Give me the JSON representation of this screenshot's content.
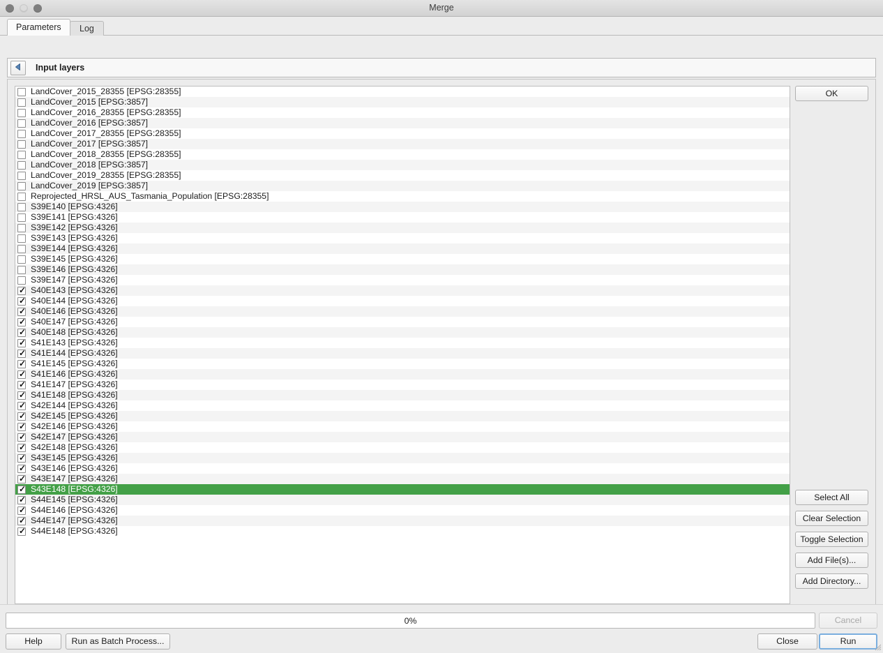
{
  "window": {
    "title": "Merge",
    "traffic_lights": [
      "close-button",
      "minimize-button",
      "zoom-button"
    ]
  },
  "tabs": [
    {
      "label": "Parameters",
      "active": true
    },
    {
      "label": "Log",
      "active": false
    }
  ],
  "parameters": {
    "section_title": "Input layers",
    "collapse_icon": "triangle-left-icon"
  },
  "layer_list": {
    "items": [
      {
        "label": "LandCover_2015_28355 [EPSG:28355]",
        "checked": false,
        "selected": false
      },
      {
        "label": "LandCover_2015 [EPSG:3857]",
        "checked": false,
        "selected": false
      },
      {
        "label": "LandCover_2016_28355 [EPSG:28355]",
        "checked": false,
        "selected": false
      },
      {
        "label": "LandCover_2016 [EPSG:3857]",
        "checked": false,
        "selected": false
      },
      {
        "label": "LandCover_2017_28355 [EPSG:28355]",
        "checked": false,
        "selected": false
      },
      {
        "label": "LandCover_2017 [EPSG:3857]",
        "checked": false,
        "selected": false
      },
      {
        "label": "LandCover_2018_28355 [EPSG:28355]",
        "checked": false,
        "selected": false
      },
      {
        "label": "LandCover_2018 [EPSG:3857]",
        "checked": false,
        "selected": false
      },
      {
        "label": "LandCover_2019_28355 [EPSG:28355]",
        "checked": false,
        "selected": false
      },
      {
        "label": "LandCover_2019 [EPSG:3857]",
        "checked": false,
        "selected": false
      },
      {
        "label": "Reprojected_HRSL_AUS_Tasmania_Population [EPSG:28355]",
        "checked": false,
        "selected": false
      },
      {
        "label": "S39E140 [EPSG:4326]",
        "checked": false,
        "selected": false
      },
      {
        "label": "S39E141 [EPSG:4326]",
        "checked": false,
        "selected": false
      },
      {
        "label": "S39E142 [EPSG:4326]",
        "checked": false,
        "selected": false
      },
      {
        "label": "S39E143 [EPSG:4326]",
        "checked": false,
        "selected": false
      },
      {
        "label": "S39E144 [EPSG:4326]",
        "checked": false,
        "selected": false
      },
      {
        "label": "S39E145 [EPSG:4326]",
        "checked": false,
        "selected": false
      },
      {
        "label": "S39E146 [EPSG:4326]",
        "checked": false,
        "selected": false
      },
      {
        "label": "S39E147 [EPSG:4326]",
        "checked": false,
        "selected": false
      },
      {
        "label": "S40E143 [EPSG:4326]",
        "checked": true,
        "selected": false
      },
      {
        "label": "S40E144 [EPSG:4326]",
        "checked": true,
        "selected": false
      },
      {
        "label": "S40E146 [EPSG:4326]",
        "checked": true,
        "selected": false
      },
      {
        "label": "S40E147 [EPSG:4326]",
        "checked": true,
        "selected": false
      },
      {
        "label": "S40E148 [EPSG:4326]",
        "checked": true,
        "selected": false
      },
      {
        "label": "S41E143 [EPSG:4326]",
        "checked": true,
        "selected": false
      },
      {
        "label": "S41E144 [EPSG:4326]",
        "checked": true,
        "selected": false
      },
      {
        "label": "S41E145 [EPSG:4326]",
        "checked": true,
        "selected": false
      },
      {
        "label": "S41E146 [EPSG:4326]",
        "checked": true,
        "selected": false
      },
      {
        "label": "S41E147 [EPSG:4326]",
        "checked": true,
        "selected": false
      },
      {
        "label": "S41E148 [EPSG:4326]",
        "checked": true,
        "selected": false
      },
      {
        "label": "S42E144 [EPSG:4326]",
        "checked": true,
        "selected": false
      },
      {
        "label": "S42E145 [EPSG:4326]",
        "checked": true,
        "selected": false
      },
      {
        "label": "S42E146 [EPSG:4326]",
        "checked": true,
        "selected": false
      },
      {
        "label": "S42E147 [EPSG:4326]",
        "checked": true,
        "selected": false
      },
      {
        "label": "S42E148 [EPSG:4326]",
        "checked": true,
        "selected": false
      },
      {
        "label": "S43E145 [EPSG:4326]",
        "checked": true,
        "selected": false
      },
      {
        "label": "S43E146 [EPSG:4326]",
        "checked": true,
        "selected": false
      },
      {
        "label": "S43E147 [EPSG:4326]",
        "checked": true,
        "selected": false
      },
      {
        "label": "S43E148 [EPSG:4326]",
        "checked": true,
        "selected": true
      },
      {
        "label": "S44E145 [EPSG:4326]",
        "checked": true,
        "selected": false
      },
      {
        "label": "S44E146 [EPSG:4326]",
        "checked": true,
        "selected": false
      },
      {
        "label": "S44E147 [EPSG:4326]",
        "checked": true,
        "selected": false
      },
      {
        "label": "S44E148 [EPSG:4326]",
        "checked": true,
        "selected": false
      }
    ],
    "selection_color": "#43a047",
    "selected_text_color": "#ffffff",
    "alt_row_color": "#f4f4f4"
  },
  "side_buttons": {
    "ok": "OK",
    "select_all": "Select All",
    "clear_selection": "Clear Selection",
    "toggle_selection": "Toggle Selection",
    "add_files": "Add File(s)...",
    "add_directory": "Add Directory..."
  },
  "progress": {
    "value_label": "0%",
    "percent": 0
  },
  "footer": {
    "help": "Help",
    "run_as_batch": "Run as Batch Process...",
    "cancel": "Cancel",
    "cancel_disabled": true,
    "close": "Close",
    "run": "Run",
    "run_is_default": true
  }
}
